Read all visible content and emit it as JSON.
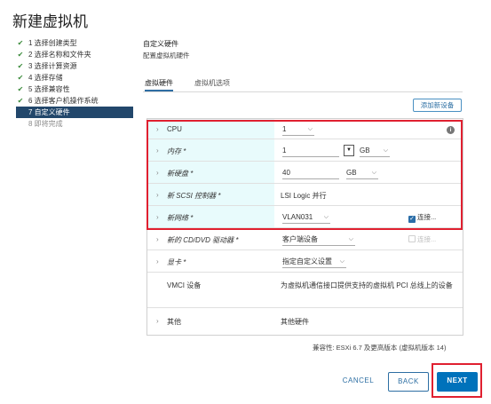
{
  "window": {
    "title": "新建虚拟机"
  },
  "steps": [
    {
      "label": "1 选择创建类型",
      "state": "done"
    },
    {
      "label": "2 选择名称和文件夹",
      "state": "done"
    },
    {
      "label": "3 选择计算资源",
      "state": "done"
    },
    {
      "label": "4 选择存储",
      "state": "done"
    },
    {
      "label": "5 选择兼容性",
      "state": "done"
    },
    {
      "label": "6 选择客户机操作系统",
      "state": "done"
    },
    {
      "label": "7 自定义硬件",
      "state": "active"
    },
    {
      "label": "8 即将完成",
      "state": "pending"
    }
  ],
  "section": {
    "title": "自定义硬件",
    "subtitle": "配置虚拟机硬件"
  },
  "tabs": [
    {
      "label": "虚拟硬件"
    },
    {
      "label": "虚拟机选项"
    }
  ],
  "add_device_label": "添加新设备",
  "hardware": {
    "cpu": {
      "name": "CPU",
      "value": "1"
    },
    "memory": {
      "name": "内存 *",
      "value": "1",
      "unit": "GB"
    },
    "disk": {
      "name": "新硬盘 *",
      "value": "40",
      "unit": "GB"
    },
    "scsi": {
      "name": "新 SCSI 控制器 *",
      "value": "LSI Logic 并行"
    },
    "network": {
      "name": "新网络 *",
      "value": "VLAN031",
      "connect_label": "连接..."
    },
    "cdrom": {
      "name": "新的 CD/DVD 驱动器 *",
      "value": "客户端设备",
      "connect_label": "连接..."
    },
    "video": {
      "name": "显卡 *",
      "value": "指定自定义设置"
    },
    "vmci": {
      "name": "VMCI 设备",
      "value": "为虚拟机通信接口提供支持的虚拟机 PCI 总线上的设备"
    },
    "other": {
      "name": "其他",
      "value": "其他硬件"
    }
  },
  "compatibility": "兼容性: ESXi 6.7 及更高版本 (虚拟机版本 14)",
  "buttons": {
    "cancel": "CANCEL",
    "back": "BACK",
    "next": "NEXT"
  },
  "colors": {
    "accent": "#0072bb",
    "active_step": "#22476b",
    "highlight": "#e02030",
    "row_highlight": "#e8fbfc"
  }
}
